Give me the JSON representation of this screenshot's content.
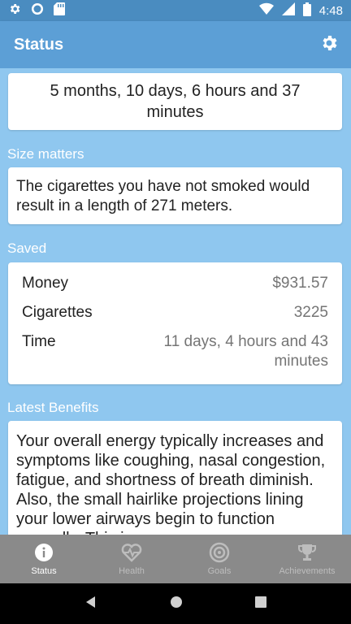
{
  "status_bar": {
    "time": "4:48",
    "icons_left": [
      "gear-icon",
      "circle-icon",
      "sd-card-icon"
    ],
    "icons_right": [
      "wifi-icon",
      "signal-icon",
      "battery-icon"
    ]
  },
  "app_bar": {
    "title": "Status",
    "settings_icon": "gear-icon"
  },
  "duration": "5 months, 10 days, 6 hours and 37 minutes",
  "size_section": {
    "label": "Size matters",
    "text": "The cigarettes you have not smoked would result in a length of 271 meters."
  },
  "saved_section": {
    "label": "Saved",
    "rows": [
      {
        "label": "Money",
        "value": "$931.57"
      },
      {
        "label": "Cigarettes",
        "value": "3225"
      },
      {
        "label": "Time",
        "value": "11 days, 4 hours and 43 minutes"
      }
    ]
  },
  "benefits_section": {
    "label": "Latest Benefits",
    "text": "Your overall energy typically increases and symptoms like coughing, nasal congestion, fatigue, and shortness of breath diminish. Also, the small hairlike projections lining your lower airways begin to function normally. This is"
  },
  "bottom_nav": {
    "items": [
      {
        "label": "Status",
        "icon": "info-icon"
      },
      {
        "label": "Health",
        "icon": "heartbeat-icon"
      },
      {
        "label": "Goals",
        "icon": "target-icon"
      },
      {
        "label": "Achievements",
        "icon": "trophy-icon"
      }
    ],
    "active_index": 0
  },
  "colors": {
    "status_bar": "#4a8cc0",
    "app_bar": "#5c9fd6",
    "background": "#8fc7ef",
    "bottom_nav": "#8a8a8a"
  }
}
